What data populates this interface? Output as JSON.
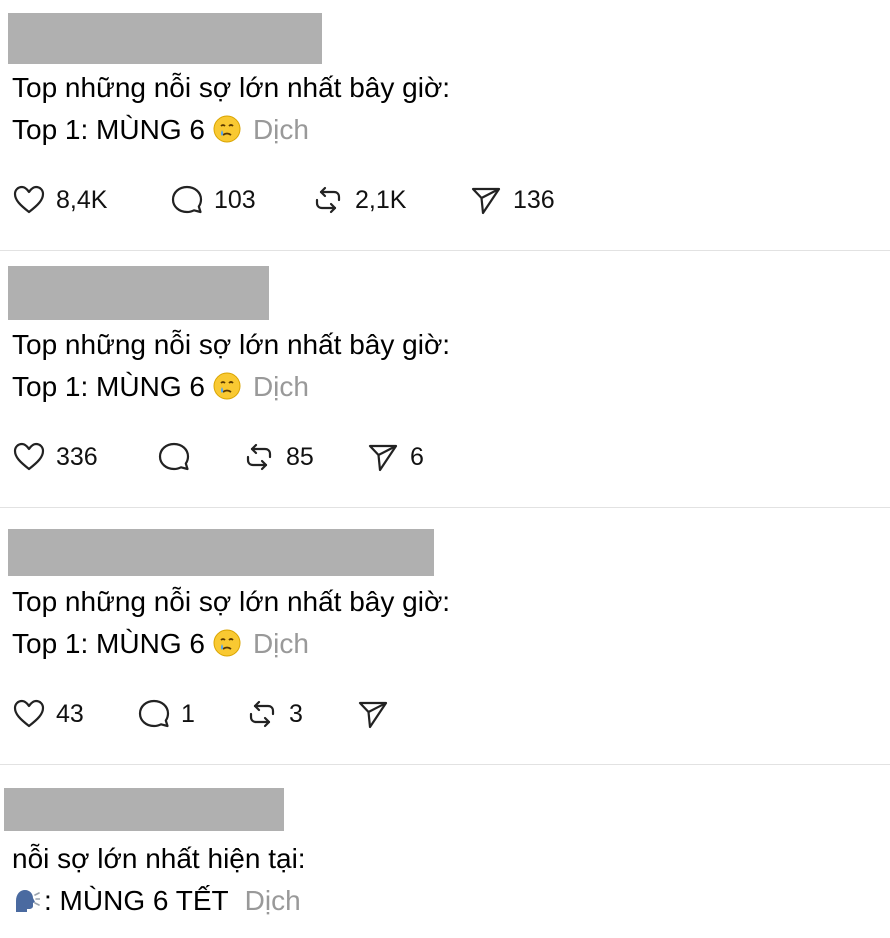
{
  "posts": [
    {
      "line1": "Top những nỗi sợ lớn nhất bây giờ:",
      "line2": "Top 1: MÙNG 6",
      "translate": "Dịch",
      "likes": "8,4K",
      "comments": "103",
      "reposts": "2,1K",
      "shares": "136"
    },
    {
      "line1": "Top những nỗi sợ lớn nhất bây giờ:",
      "line2": "Top 1: MÙNG 6",
      "translate": "Dịch",
      "likes": "336",
      "comments": "",
      "reposts": "85",
      "shares": "6"
    },
    {
      "line1": "Top những nỗi sợ lớn nhất bây giờ:",
      "line2": "Top 1: MÙNG 6",
      "translate": "Dịch",
      "likes": "43",
      "comments": "1",
      "reposts": "3",
      "shares": ""
    },
    {
      "line1": "nỗi sợ lớn nhất hiện tại:",
      "line2": ": MÙNG 6 TẾT",
      "translate": "Dịch"
    }
  ],
  "icons": {
    "like": "heart-icon",
    "comment": "comment-icon",
    "repost": "repost-icon",
    "share": "send-icon",
    "emoji1": "crying-face-emoji",
    "emoji2": "speaking-head-emoji"
  },
  "colors": {
    "text": "#000000",
    "translate": "#999999",
    "redaction": "#b0b0b0",
    "divider": "#e2e2e2"
  }
}
